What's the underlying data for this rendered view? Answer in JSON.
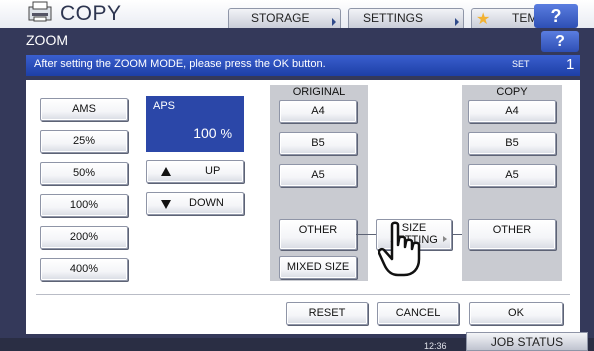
{
  "header": {
    "app_title": "COPY",
    "tabs": [
      {
        "label": "STORAGE"
      },
      {
        "label": "SETTINGS"
      },
      {
        "label": "TEMPLATE"
      }
    ],
    "help_label": "?"
  },
  "dialog": {
    "title": "ZOOM",
    "help_label": "?",
    "message": "After setting the ZOOM MODE, please press the OK button.",
    "set_label": "SET",
    "set_value": "1"
  },
  "zoom_presets": [
    "AMS",
    "25%",
    "50%",
    "100%",
    "200%",
    "400%"
  ],
  "aps": {
    "label": "APS",
    "value": "100",
    "unit": "%"
  },
  "adjust": {
    "up_label": "UP",
    "down_label": "DOWN"
  },
  "original": {
    "header": "ORIGINAL",
    "sizes": [
      "A4",
      "B5",
      "A5"
    ],
    "other_label": "OTHER",
    "mixed_label": "MIXED SIZE"
  },
  "size_setting": {
    "line1": "SIZE",
    "line2": "SETTING"
  },
  "copy": {
    "header": "COPY",
    "sizes": [
      "A4",
      "B5",
      "A5"
    ],
    "other_label": "OTHER"
  },
  "footer_buttons": {
    "reset": "RESET",
    "cancel": "CANCEL",
    "ok": "OK"
  },
  "statusbar": {
    "time": "12:36",
    "job_status": "JOB STATUS"
  },
  "colors": {
    "accent_blue": "#2b47a8",
    "dialog_frame": "#34395a",
    "column_gray": "#c9cbd1",
    "star": "#f2b233"
  }
}
